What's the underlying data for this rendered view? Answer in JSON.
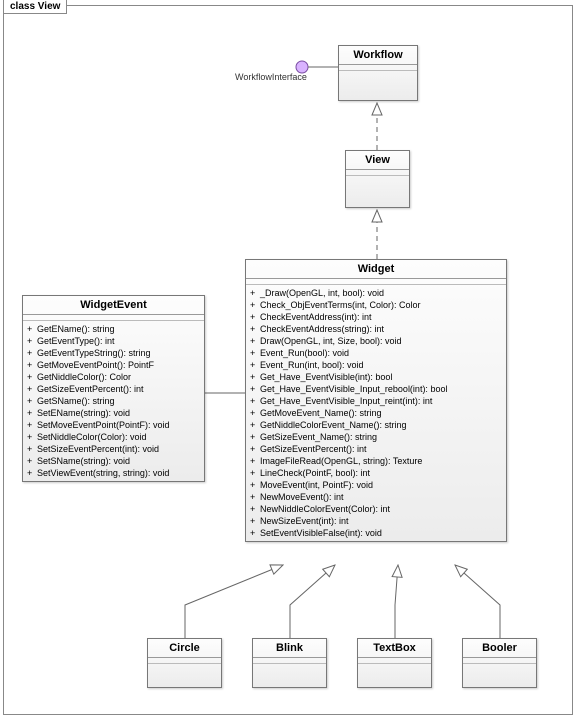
{
  "frame": {
    "title": "class View"
  },
  "interface_label": "WorkflowInterface",
  "classes": {
    "workflow": {
      "name": "Workflow"
    },
    "view": {
      "name": "View"
    },
    "widget": {
      "name": "Widget",
      "ops": [
        "_Draw(OpenGL, int, bool): void",
        "Check_ObjEventTerms(int, Color): Color",
        "CheckEventAddress(int): int",
        "CheckEventAddress(string): int",
        "Draw(OpenGL, int, Size, bool): void",
        "Event_Run(bool): void",
        "Event_Run(int, bool): void",
        "Get_Have_EventVisible(int): bool",
        "Get_Have_EventVisible_Input_rebool(int): bool",
        "Get_Have_EventVisible_Input_reint(int): int",
        "GetMoveEvent_Name(): string",
        "GetNiddleColorEvent_Name(): string",
        "GetSizeEvent_Name(): string",
        "GetSizeEventPercent(): int",
        "ImageFileRead(OpenGL, string): Texture",
        "LineCheck(PointF, bool): int",
        "MoveEvent(int, PointF): void",
        "NewMoveEvent(): int",
        "NewNiddleColorEvent(Color): int",
        "NewSizeEvent(int): int",
        "SetEventVisibleFalse(int): void"
      ]
    },
    "widgetEvent": {
      "name": "WidgetEvent",
      "ops": [
        "GetEName(): string",
        "GetEventType(): int",
        "GetEventTypeString(): string",
        "GetMoveEventPoint(): PointF",
        "GetNiddleColor(): Color",
        "GetSizeEventPercent(): int",
        "GetSName(): string",
        "SetEName(string): void",
        "SetMoveEventPoint(PointF): void",
        "SetNiddleColor(Color): void",
        "SetSizeEventPercent(int): void",
        "SetSName(string): void",
        "SetViewEvent(string, string): void"
      ]
    },
    "circle": {
      "name": "Circle"
    },
    "blink": {
      "name": "Blink"
    },
    "textbox": {
      "name": "TextBox"
    },
    "booler": {
      "name": "Booler"
    }
  }
}
